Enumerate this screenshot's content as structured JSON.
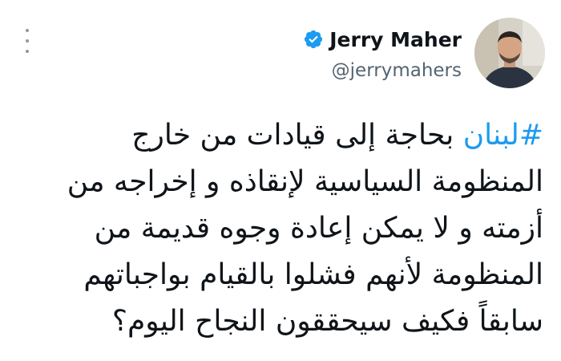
{
  "tweet": {
    "author": {
      "display_name": "Jerry Maher",
      "handle": "@jerrymahers",
      "verified": true,
      "avatar_icon": "profile-photo"
    },
    "hashtag": "#لبنان",
    "lines": [
      " بحاجة إلى قيادات من خارج",
      "المنظومة السياسية لإنقاذه و إخراجه من",
      "أزمته و لا يمكن إعادة وجوه قديمة من",
      "المنظومة لأنهم فشلوا بالقيام بواجباتهم",
      "سابقاً فكيف سيحققون النجاح اليوم؟"
    ],
    "more_icon": "more-options-icon"
  },
  "colors": {
    "link": "#1d9bf0",
    "verified_badge": "#1d9bf0",
    "text": "#0f1419",
    "secondary_text": "#536471",
    "icon_gray": "#8b98a5"
  }
}
